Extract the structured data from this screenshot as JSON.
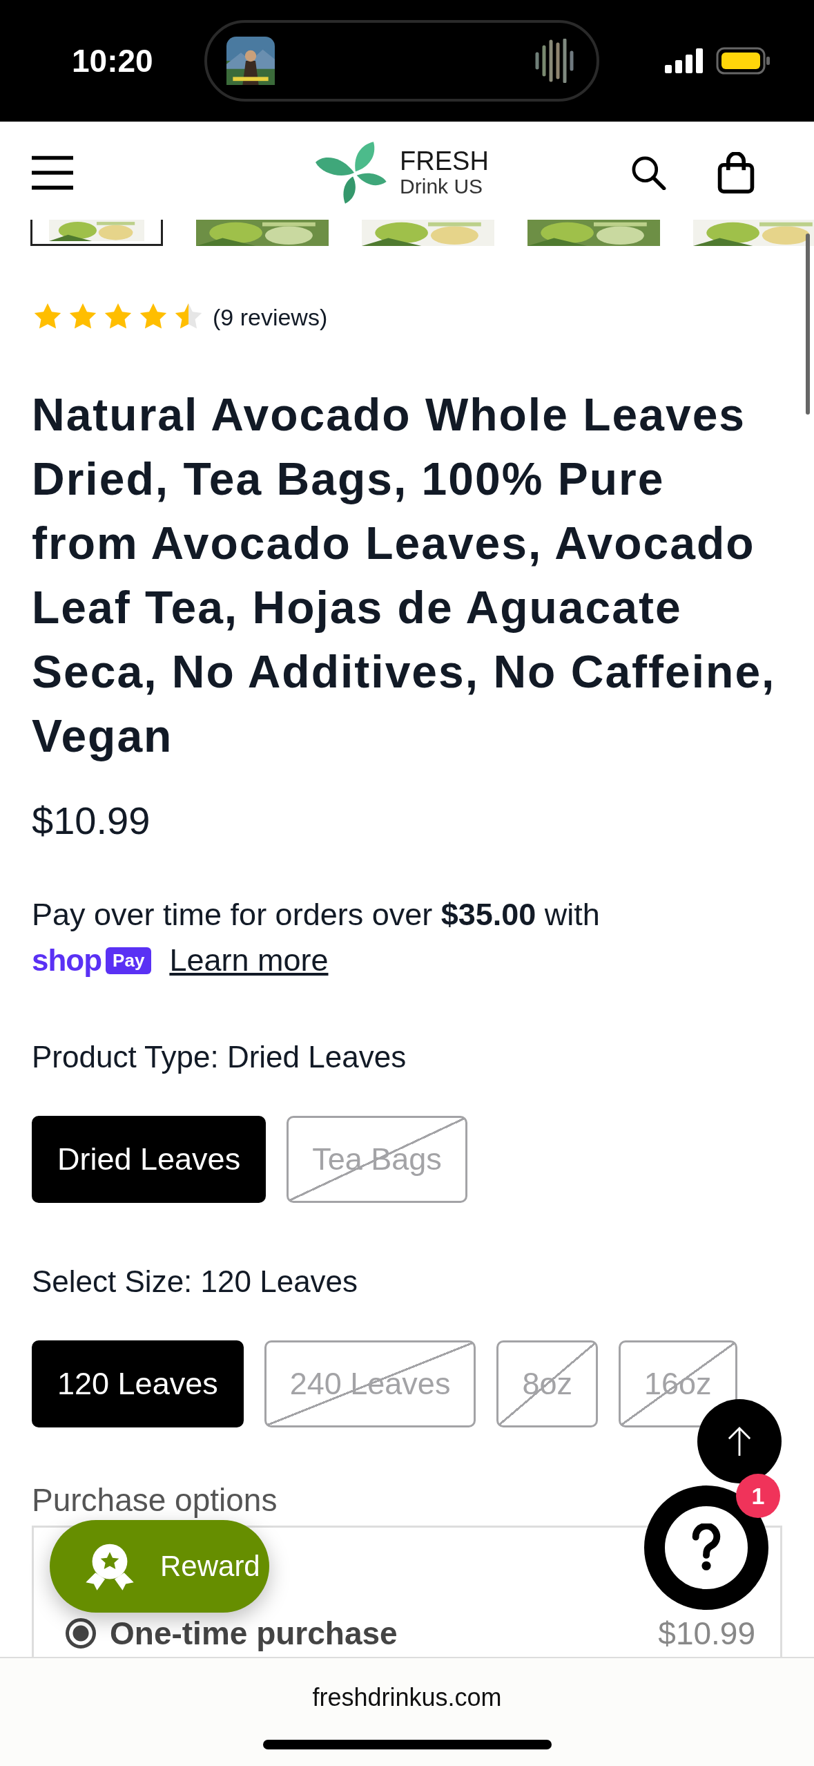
{
  "status_bar": {
    "time": "10:20"
  },
  "header": {
    "logo_top": "FRESH",
    "logo_bottom": "Drink US"
  },
  "thumbnails": [
    {
      "kind": "picture",
      "selected": true
    },
    {
      "kind": "picture",
      "selected": false
    },
    {
      "kind": "picture",
      "selected": false
    },
    {
      "kind": "picture",
      "selected": false
    },
    {
      "kind": "picture",
      "selected": false
    }
  ],
  "rating": {
    "stars": 4.5,
    "reviews": "(9 reviews)"
  },
  "product": {
    "title": "Natural Avocado Whole Leaves Dried, Tea Bags, 100% Pure from Avocado Leaves, Avocado Leaf Tea, Hojas de Aguacate Seca, No Additives, No Caffeine, Vegan",
    "price": "$10.99"
  },
  "installments": {
    "text": "Pay over time for orders over **$35.00** with",
    "shop_label": "shop",
    "pay_label": "Pay",
    "link": "Learn more"
  },
  "product_type": {
    "label": "Product Type: Dried Leaves",
    "options": [
      {
        "label": "Dried Leaves",
        "selected": true,
        "disabled": false
      },
      {
        "label": "Tea Bags",
        "selected": false,
        "disabled": true
      }
    ]
  },
  "size": {
    "label": "Select Size: 120 Leaves",
    "options": [
      {
        "label": "120 Leaves",
        "selected": true,
        "disabled": false
      },
      {
        "label": "240 Leaves",
        "selected": false,
        "disabled": true
      },
      {
        "label": "8oz",
        "selected": false,
        "disabled": true
      },
      {
        "label": "16oz",
        "selected": false,
        "disabled": true
      }
    ]
  },
  "purchase": {
    "heading": "Purchase options",
    "options": [
      {
        "label": "One-time purchase",
        "price": "$10.99",
        "selected": true
      }
    ]
  },
  "reward_button": {
    "label": "Reward"
  },
  "help_button": {
    "badge": "1"
  },
  "browser_bar": {
    "url": "freshdrinkus.com"
  }
}
